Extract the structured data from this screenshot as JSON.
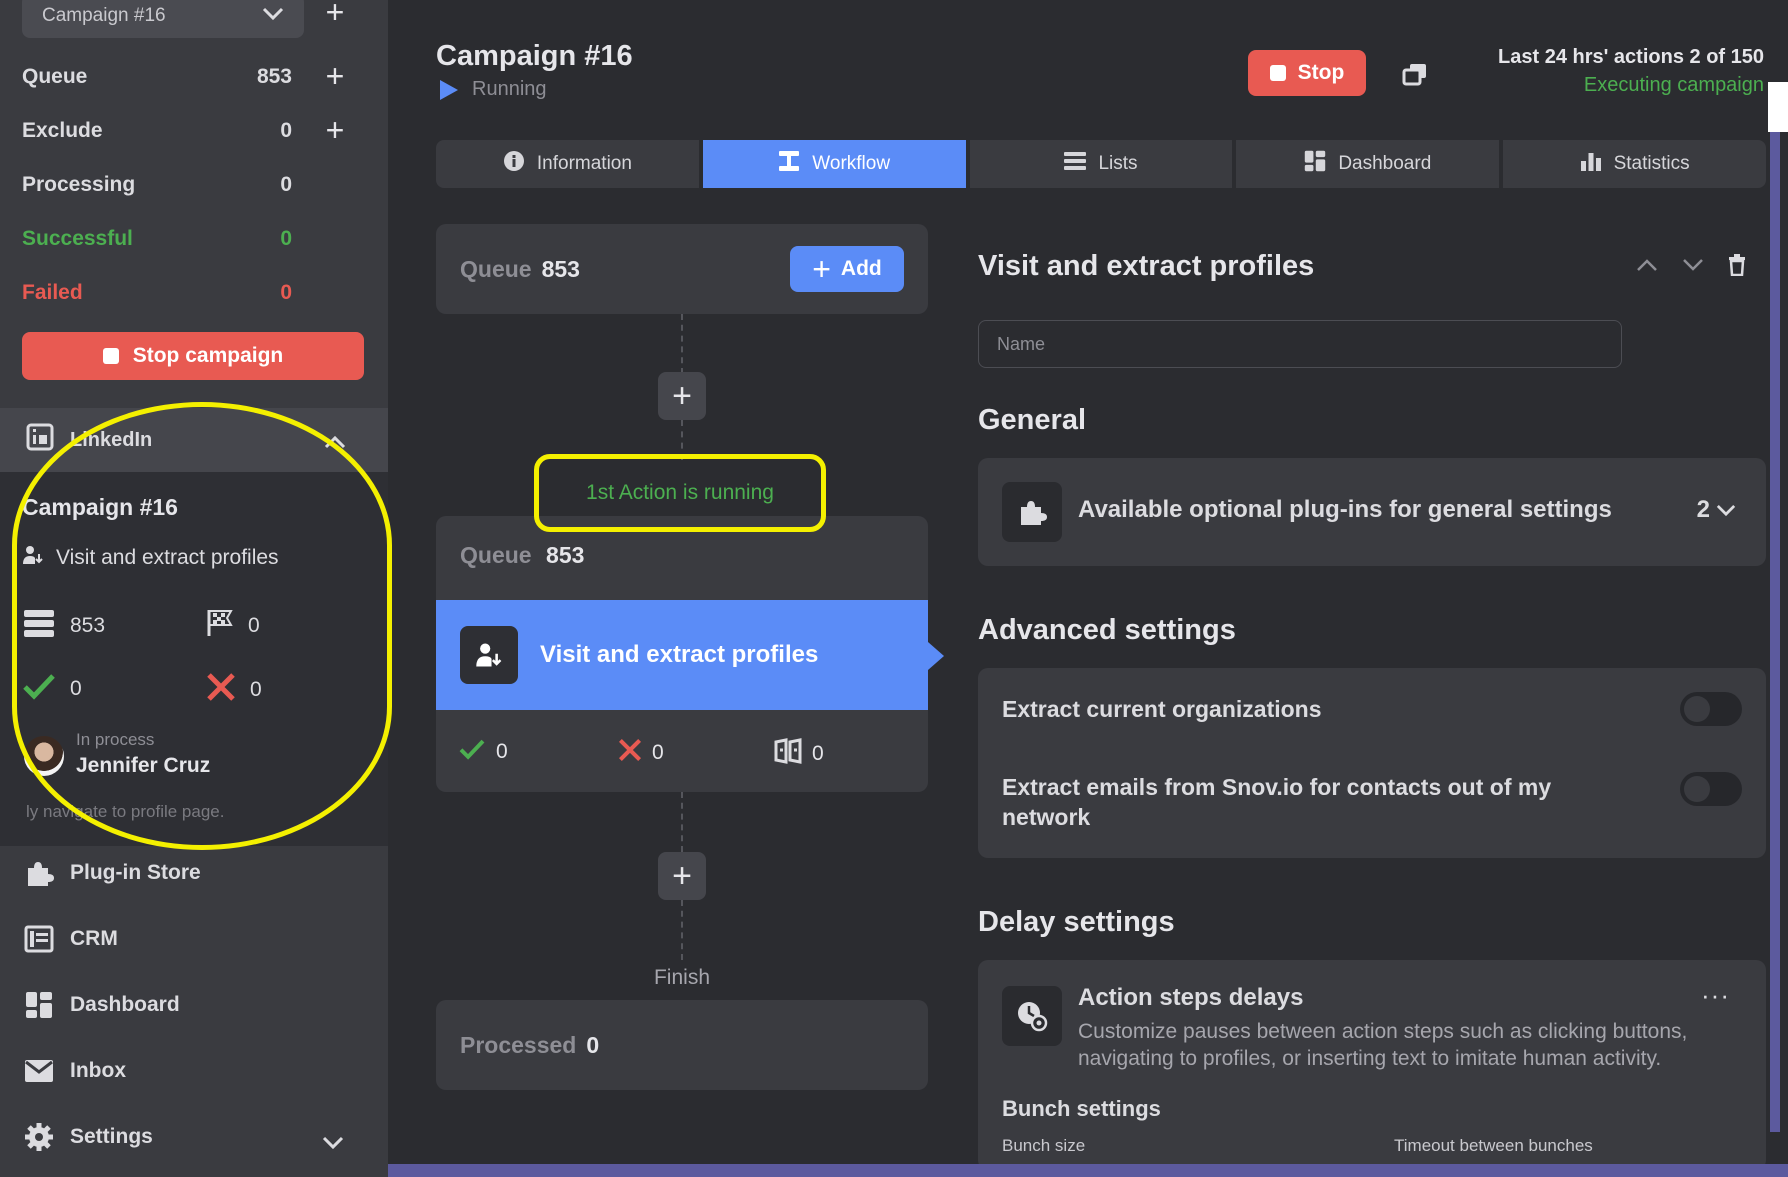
{
  "sidebar": {
    "campaign_select": "Campaign #16",
    "stats": [
      {
        "label": "Queue",
        "value": "853"
      },
      {
        "label": "Exclude",
        "value": "0"
      },
      {
        "label": "Processing",
        "value": "0"
      },
      {
        "label": "Successful",
        "value": "0"
      },
      {
        "label": "Failed",
        "value": "0"
      }
    ],
    "stop_campaign": "Stop campaign",
    "linkedin": {
      "header": "LinkedIn",
      "campaign": "Campaign #16",
      "action": "Visit and extract profiles",
      "queue": "853",
      "finished": "0",
      "success": "0",
      "failed": "0",
      "in_process_label": "In process",
      "person": "Jennifer Cruz",
      "message": "ly navigate to profile page."
    },
    "nav": [
      {
        "label": "Plug-in Store",
        "icon": "puzzle-icon"
      },
      {
        "label": "CRM",
        "icon": "crm-icon"
      },
      {
        "label": "Dashboard",
        "icon": "dashboard-icon"
      },
      {
        "label": "Inbox",
        "icon": "envelope-icon"
      },
      {
        "label": "Settings",
        "icon": "gear-icon"
      }
    ]
  },
  "header": {
    "title": "Campaign #16",
    "status": "Running",
    "stop": "Stop",
    "actions": "Last 24 hrs' actions 2 of 150",
    "executing": "Executing campaign"
  },
  "tabs": [
    {
      "label": "Information",
      "icon": "info-icon"
    },
    {
      "label": "Workflow",
      "icon": "workflow-icon"
    },
    {
      "label": "Lists",
      "icon": "lists-icon"
    },
    {
      "label": "Dashboard",
      "icon": "dashboard-icon"
    },
    {
      "label": "Statistics",
      "icon": "statistics-icon"
    }
  ],
  "workflow": {
    "queue_label": "Queue",
    "queue_value": "853",
    "add": "Add",
    "running": "1st Action is running",
    "step_queue_label": "Queue",
    "step_queue_value": "853",
    "action_name": "Visit and extract profiles",
    "success": "0",
    "failed": "0",
    "skipped": "0",
    "finish": "Finish",
    "processed_label": "Processed",
    "processed_value": "0"
  },
  "panel": {
    "title": "Visit and extract profiles",
    "name_placeholder": "Name",
    "general": "General",
    "plugins_label": "Available optional plug-ins for general settings",
    "plugins_count": "2",
    "advanced": "Advanced settings",
    "adv_1": "Extract current organizations",
    "adv_2_line1": "Extract emails from Snov.io for contacts out of my",
    "adv_2_line2": "network",
    "delay": "Delay settings",
    "delay_title": "Action steps delays",
    "delay_desc_1": "Customize pauses between action steps such as clicking buttons,",
    "delay_desc_2": "navigating to profiles, or inserting text to imitate human activity.",
    "bunch": "Bunch settings",
    "bunch_size": "Bunch size",
    "bunch_timeout": "Timeout between bunches"
  },
  "colors": {
    "accent": "#5b8cf7",
    "danger": "#e85a52",
    "success": "#4caf50",
    "highlight": "#f4f000"
  }
}
